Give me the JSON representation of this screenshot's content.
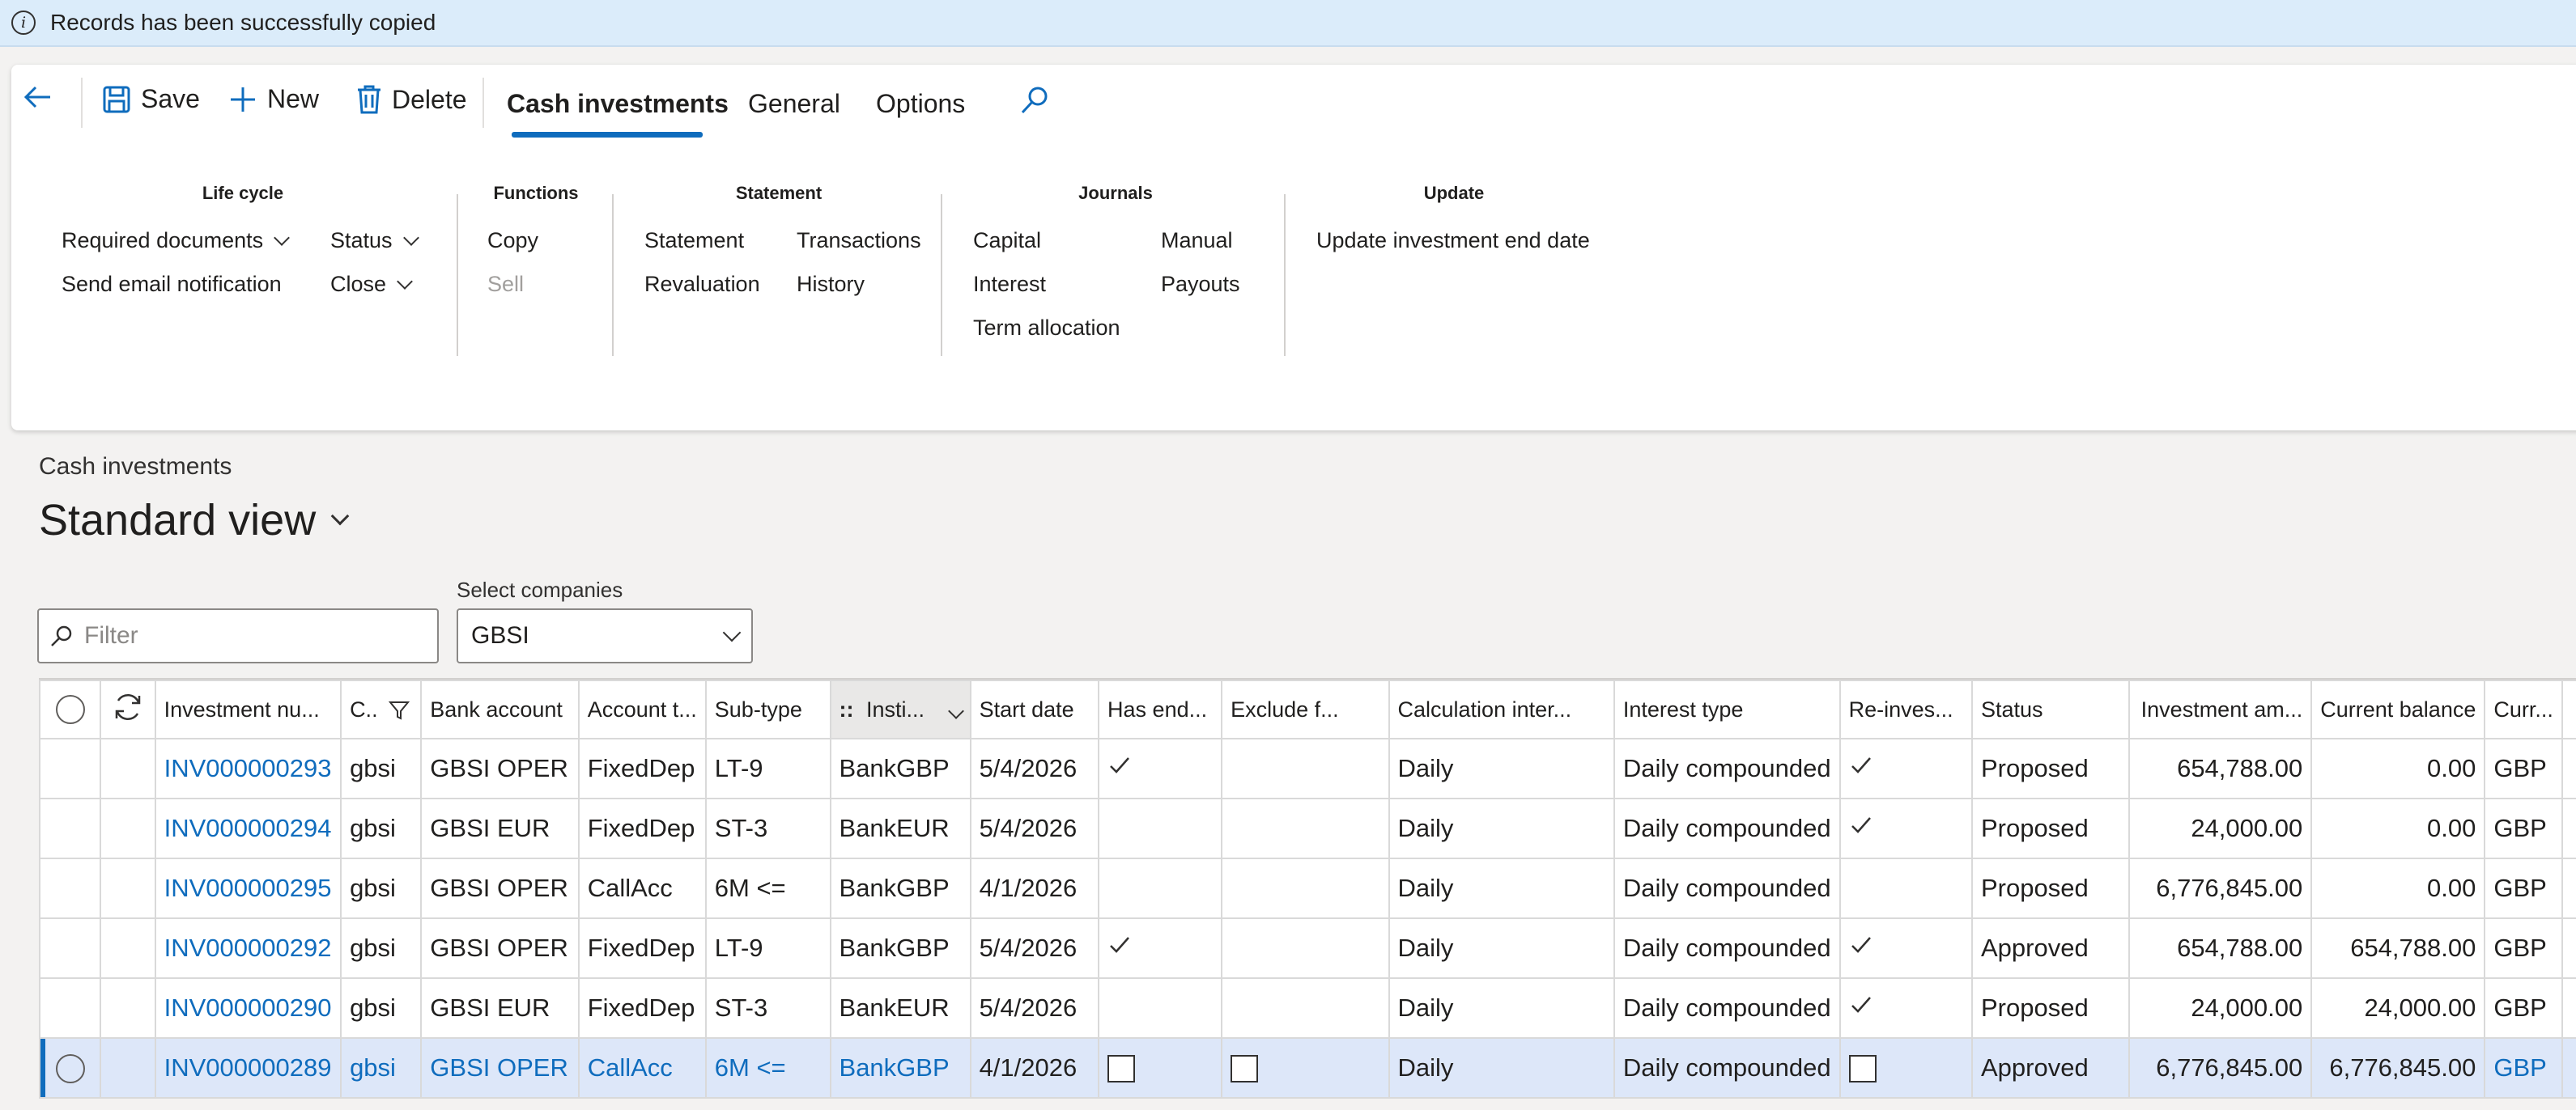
{
  "message_bar": {
    "text": "Records has been successfully copied"
  },
  "toolbar": {
    "save_label": "Save",
    "new_label": "New",
    "delete_label": "Delete",
    "tabs": [
      "Cash investments",
      "General",
      "Options"
    ]
  },
  "groups": {
    "life_cycle": {
      "title": "Life cycle",
      "required_documents": "Required documents",
      "status": "Status",
      "send_email": "Send email notification",
      "close": "Close"
    },
    "functions": {
      "title": "Functions",
      "copy": "Copy",
      "sell": "Sell"
    },
    "statement": {
      "title": "Statement",
      "statement": "Statement",
      "transactions": "Transactions",
      "revaluation": "Revaluation",
      "history": "History"
    },
    "journals": {
      "title": "Journals",
      "capital": "Capital",
      "manual": "Manual",
      "interest": "Interest",
      "payouts": "Payouts",
      "term_allocation": "Term allocation"
    },
    "update": {
      "title": "Update",
      "update_end_date": "Update investment end date"
    }
  },
  "page": {
    "caption": "Cash investments",
    "view_title": "Standard view"
  },
  "filter": {
    "placeholder": "Filter"
  },
  "companies": {
    "label": "Select companies",
    "value": "GBSI"
  },
  "grid": {
    "columns": [
      "Investment nu...",
      "C..",
      "Bank account",
      "Account t...",
      "Sub-type",
      "Insti...",
      "Start date",
      "Has end...",
      "Exclude f...",
      "Calculation inter...",
      "Interest type",
      "Re-inves...",
      "Status",
      "Investment am...",
      "Current balance",
      "Curr..."
    ],
    "rows": [
      {
        "investment_number": "INV000000293",
        "company": "gbsi",
        "bank_account": "GBSI OPER",
        "account_type": "FixedDep",
        "sub_type": "LT-9",
        "institution": "BankGBP",
        "start_date": "5/4/2026",
        "has_end": true,
        "exclude": false,
        "calc_interval": "Daily",
        "interest_type": "Daily compounded",
        "reinvest": true,
        "status": "Proposed",
        "investment_amount": "654,788.00",
        "current_balance": "0.00",
        "currency": "GBP"
      },
      {
        "investment_number": "INV000000294",
        "company": "gbsi",
        "bank_account": "GBSI EUR",
        "account_type": "FixedDep",
        "sub_type": "ST-3",
        "institution": "BankEUR",
        "start_date": "5/4/2026",
        "has_end": false,
        "exclude": false,
        "calc_interval": "Daily",
        "interest_type": "Daily compounded",
        "reinvest": true,
        "status": "Proposed",
        "investment_amount": "24,000.00",
        "current_balance": "0.00",
        "currency": "GBP"
      },
      {
        "investment_number": "INV000000295",
        "company": "gbsi",
        "bank_account": "GBSI OPER",
        "account_type": "CallAcc",
        "sub_type": "6M <=",
        "institution": "BankGBP",
        "start_date": "4/1/2026",
        "has_end": false,
        "exclude": false,
        "calc_interval": "Daily",
        "interest_type": "Daily compounded",
        "reinvest": false,
        "status": "Proposed",
        "investment_amount": "6,776,845.00",
        "current_balance": "0.00",
        "currency": "GBP"
      },
      {
        "investment_number": "INV000000292",
        "company": "gbsi",
        "bank_account": "GBSI OPER",
        "account_type": "FixedDep",
        "sub_type": "LT-9",
        "institution": "BankGBP",
        "start_date": "5/4/2026",
        "has_end": true,
        "exclude": false,
        "calc_interval": "Daily",
        "interest_type": "Daily compounded",
        "reinvest": true,
        "status": "Approved",
        "investment_amount": "654,788.00",
        "current_balance": "654,788.00",
        "currency": "GBP"
      },
      {
        "investment_number": "INV000000290",
        "company": "gbsi",
        "bank_account": "GBSI EUR",
        "account_type": "FixedDep",
        "sub_type": "ST-3",
        "institution": "BankEUR",
        "start_date": "5/4/2026",
        "has_end": false,
        "exclude": false,
        "calc_interval": "Daily",
        "interest_type": "Daily compounded",
        "reinvest": true,
        "status": "Proposed",
        "investment_amount": "24,000.00",
        "current_balance": "24,000.00",
        "currency": "GBP"
      },
      {
        "investment_number": "INV000000289",
        "company": "gbsi",
        "bank_account": "GBSI OPER",
        "account_type": "CallAcc",
        "sub_type": "6M <=",
        "institution": "BankGBP",
        "start_date": "4/1/2026",
        "has_end": false,
        "exclude": false,
        "calc_interval": "Daily",
        "interest_type": "Daily compounded",
        "reinvest": false,
        "status": "Approved",
        "investment_amount": "6,776,845.00",
        "current_balance": "6,776,845.00",
        "currency": "GBP",
        "selected": true
      }
    ]
  },
  "colors": {
    "accent": "#0f6cbd",
    "message_bg": "#dbecfa",
    "selected_row": "#dde7f9"
  }
}
